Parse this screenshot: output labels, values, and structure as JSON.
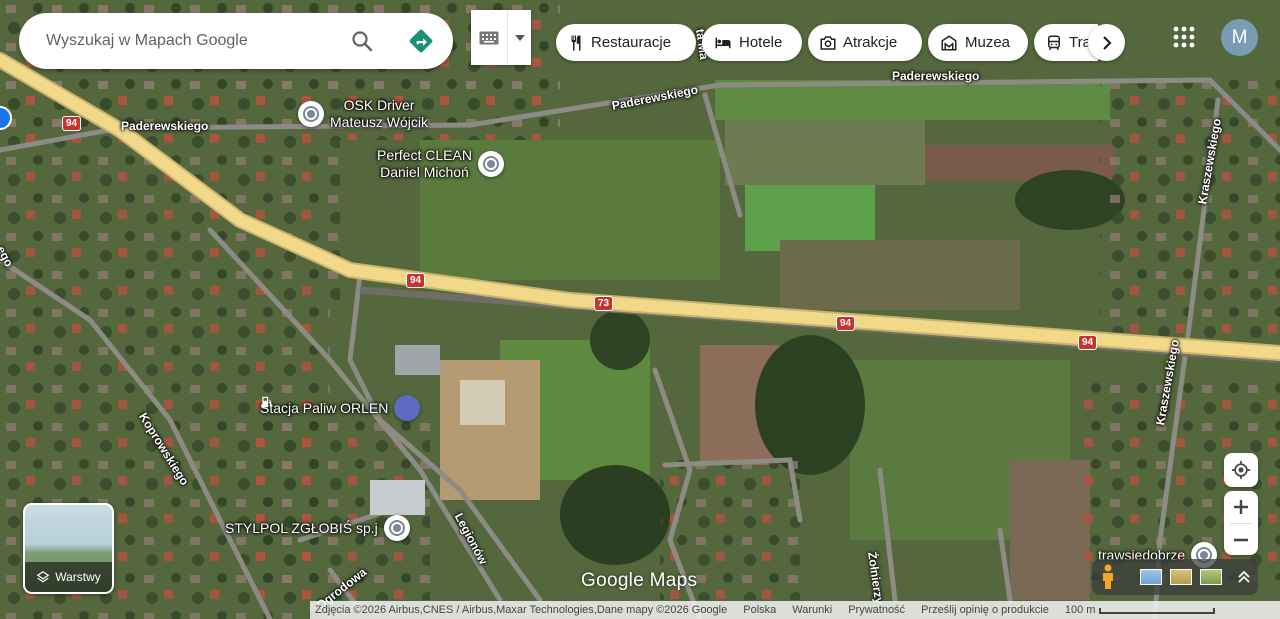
{
  "search": {
    "placeholder": "Wyszukaj w Mapach Google"
  },
  "chips": [
    {
      "label": "Restauracje",
      "icon": "restaurant-icon"
    },
    {
      "label": "Hotele",
      "icon": "hotel-icon"
    },
    {
      "label": "Atrakcje",
      "icon": "camera-icon"
    },
    {
      "label": "Muzea",
      "icon": "museum-icon"
    },
    {
      "label": "Tra",
      "icon": "transit-icon"
    }
  ],
  "account": {
    "initial": "M",
    "color": "#7a9cb2"
  },
  "map": {
    "roads": {
      "paderewskiego_1": "Paderewskiego",
      "paderewskiego_2": "Paderewskiego",
      "paderewskiego_3": "Paderewskiego",
      "kraszewskiego_1": "Kraszewskiego",
      "kraszewskiego_2": "Kraszewskiego",
      "koprowskiego": "Koprowskiego",
      "legionow": "Legionów",
      "ogrodowa": "Ogrodowa",
      "zolnierzy": "Żołnierzy",
      "ta_ma": "ta Ma",
      "ego": "ego"
    },
    "shields": {
      "s1": "94",
      "s2": "94",
      "s3": "73",
      "s4": "94",
      "s5": "94"
    },
    "pois": {
      "osk": {
        "line1": "OSK Driver",
        "line2": "Mateusz Wójcik"
      },
      "perfect": {
        "line1": "Perfect CLEAN",
        "line2": "Daniel Michoń"
      },
      "orlen": {
        "line1": "Stacja Paliw ORLEN"
      },
      "stylpol": {
        "line1": "STYLPOL ZGŁOBIŚ sp.j"
      },
      "trawsie": {
        "line1": "trawsiedobrze"
      }
    }
  },
  "layers_label": "Warstwy",
  "logo": "Google Maps",
  "footer": {
    "attribution": "Zdjęcia ©2026 Airbus,CNES / Airbus,Maxar Technologies,Dane mapy ©2026 Google",
    "country": "Polska",
    "terms": "Warunki",
    "privacy": "Prywatność",
    "feedback": "Prześlij opinię o produkcie",
    "scale": "100 m"
  },
  "colors": {
    "highway": "#f2d98a",
    "shield": "#c8332d",
    "fuel_pin": "#5c6bc0"
  }
}
